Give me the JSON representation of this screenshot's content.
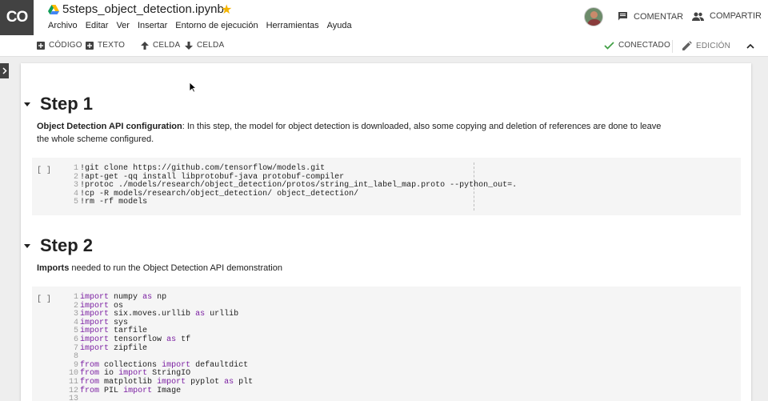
{
  "header": {
    "logo_text": "CO",
    "notebook_title": "5steps_object_detection.ipynb",
    "menu": [
      "Archivo",
      "Editar",
      "Ver",
      "Insertar",
      "Entorno de ejecución",
      "Herramientas",
      "Ayuda"
    ],
    "comment_label": "COMENTAR",
    "share_label": "COMPARTIR"
  },
  "toolbar": {
    "add_code_label": "CÓDIGO",
    "add_text_label": "TEXTO",
    "move_up_label": "CELDA",
    "move_down_label": "CELDA",
    "connected_label": "CONECTADO",
    "edit_label": "EDICIÓN"
  },
  "colors": {
    "logo_bg": "#424242",
    "star": "#f4b400",
    "connected": "#43a047",
    "keyword": "#7b1fa2"
  },
  "sections": [
    {
      "title": "Step 1",
      "text_bold": "Object Detection API configuration",
      "text_rest": ": In this step, the model for object detection is downloaded, also some copying and deletion of references are done to leave the whole scheme configured.",
      "run_marker": "[ ]",
      "code_lines": [
        "!git clone https://github.com/tensorflow/models.git",
        "!apt-get -qq install libprotobuf-java protobuf-compiler",
        "!protoc ./models/research/object_detection/protos/string_int_label_map.proto --python_out=.",
        "!cp -R models/research/object_detection/ object_detection/",
        "!rm -rf models"
      ]
    },
    {
      "title": "Step 2",
      "text_bold": "Imports",
      "text_rest": " needed to run the Object Detection API demonstration",
      "run_marker": "[ ]",
      "code_lines": [
        "import numpy as np",
        "import os",
        "import six.moves.urllib as urllib",
        "import sys",
        "import tarfile",
        "import tensorflow as tf",
        "import zipfile",
        "",
        "from collections import defaultdict",
        "from io import StringIO",
        "from matplotlib import pyplot as plt",
        "from PIL import Image",
        ""
      ]
    }
  ]
}
